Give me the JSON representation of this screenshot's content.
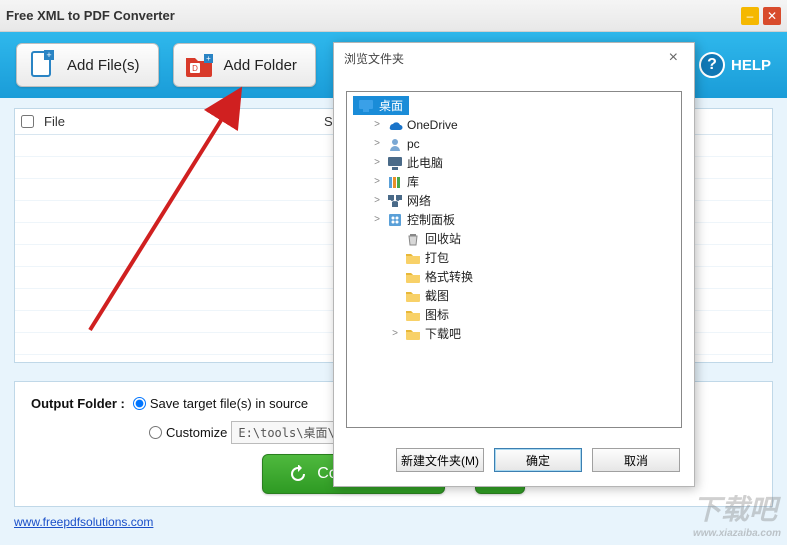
{
  "window": {
    "title": "Free XML to PDF Converter"
  },
  "toolbar": {
    "add_files": "Add File(s)",
    "add_folder": "Add Folder",
    "help": "HELP"
  },
  "list": {
    "col_file": "File",
    "col_status": "S"
  },
  "output": {
    "label": "Output Folder :",
    "opt_source": "Save target file(s) in source",
    "opt_custom": "Customize",
    "custom_path": "E:\\tools\\桌面\\下载吧",
    "convert": "Convert Selec"
  },
  "footer": {
    "link": "www.freepdfsolutions.com"
  },
  "dialog": {
    "title": "浏览文件夹",
    "root": "桌面",
    "items": [
      {
        "exp": ">",
        "icon": "onedrive",
        "label": "OneDrive",
        "indent": 1
      },
      {
        "exp": ">",
        "icon": "user",
        "label": "pc",
        "indent": 1
      },
      {
        "exp": ">",
        "icon": "pc",
        "label": "此电脑",
        "indent": 1
      },
      {
        "exp": ">",
        "icon": "lib",
        "label": "库",
        "indent": 1
      },
      {
        "exp": ">",
        "icon": "net",
        "label": "网络",
        "indent": 1
      },
      {
        "exp": ">",
        "icon": "panel",
        "label": "控制面板",
        "indent": 1
      },
      {
        "exp": "",
        "icon": "recycle",
        "label": "回收站",
        "indent": 2
      },
      {
        "exp": "",
        "icon": "folder",
        "label": "打包",
        "indent": 2
      },
      {
        "exp": "",
        "icon": "folder",
        "label": "格式转换",
        "indent": 2
      },
      {
        "exp": "",
        "icon": "folder",
        "label": "截图",
        "indent": 2
      },
      {
        "exp": "",
        "icon": "folder",
        "label": "图标",
        "indent": 2
      },
      {
        "exp": ">",
        "icon": "folder",
        "label": "下载吧",
        "indent": 2
      }
    ],
    "new_folder": "新建文件夹(M)",
    "ok": "确定",
    "cancel": "取消"
  },
  "watermark": {
    "text": "下载吧",
    "url": "www.xiazaiba.com"
  }
}
